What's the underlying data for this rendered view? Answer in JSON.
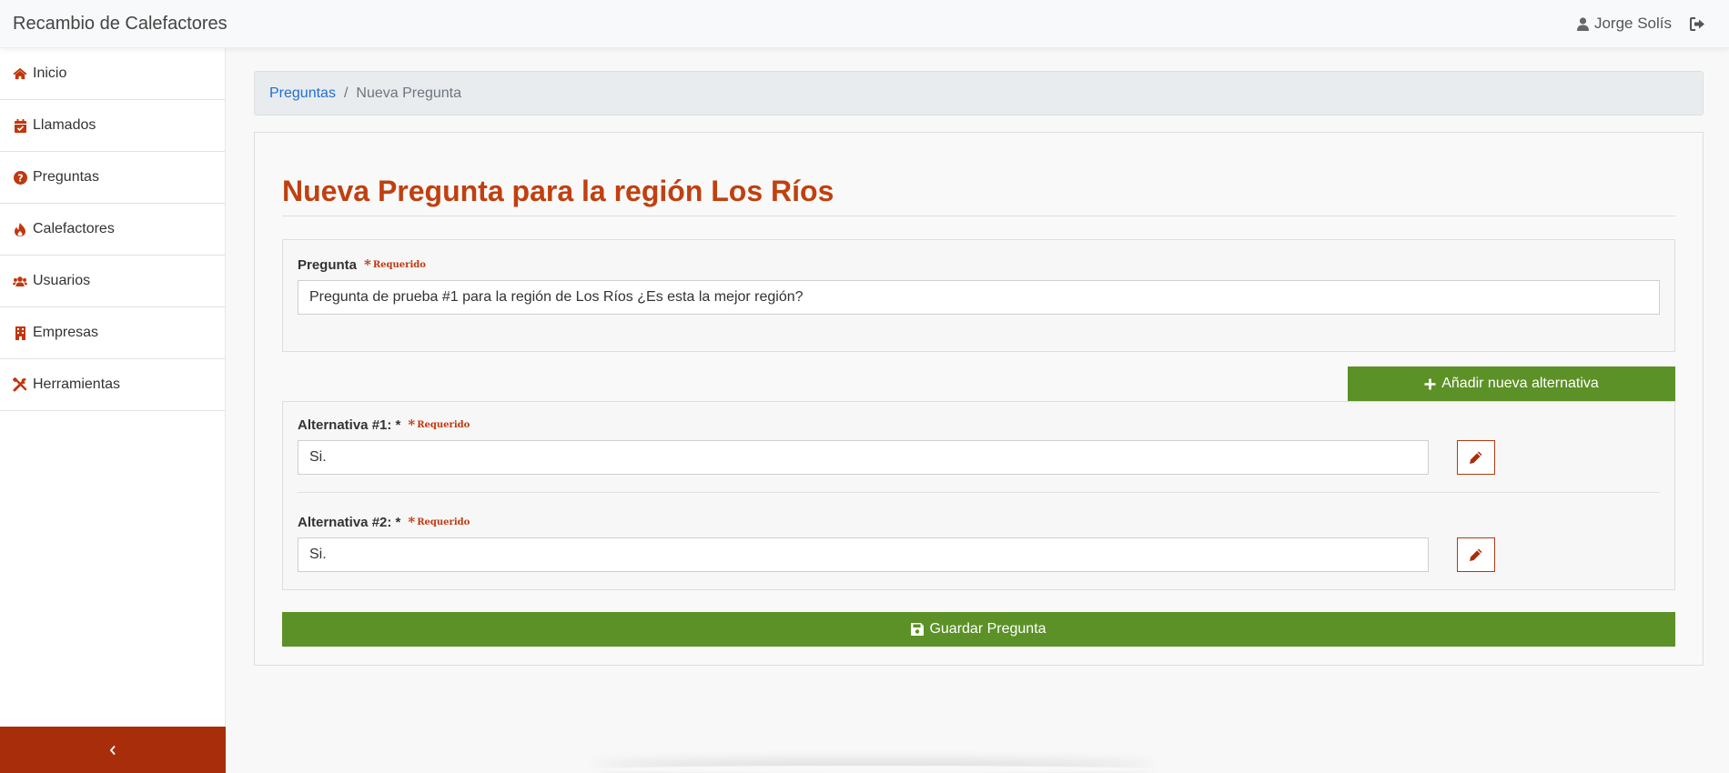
{
  "app": {
    "title": "Recambio de Calefactores",
    "user_name": "Jorge Solís",
    "accent_color": "#c0400f",
    "success_color": "#5b9126"
  },
  "sidebar": {
    "items": [
      {
        "label": "Inicio",
        "icon": "home-icon"
      },
      {
        "label": "Llamados",
        "icon": "calendar-check-icon"
      },
      {
        "label": "Preguntas",
        "icon": "question-circle-icon"
      },
      {
        "label": "Calefactores",
        "icon": "fire-icon"
      },
      {
        "label": "Usuarios",
        "icon": "users-icon"
      },
      {
        "label": "Empresas",
        "icon": "building-icon"
      },
      {
        "label": "Herramientas",
        "icon": "tools-icon"
      }
    ],
    "toggle_icon": "chevron-left-icon"
  },
  "breadcrumb": {
    "link": "Preguntas",
    "separator": "/",
    "current": "Nueva Pregunta"
  },
  "form": {
    "title": "Nueva Pregunta para la región Los Ríos",
    "question": {
      "label": "Pregunta",
      "required_text": "Requerido",
      "value": "Pregunta de prueba #1 para la región de Los Ríos ¿Es esta la mejor región?"
    },
    "add_alternative_label": "Añadir nueva alternativa",
    "alternatives": [
      {
        "label": "Alternativa #1: *",
        "required_text": "Requerido",
        "value": "Si."
      },
      {
        "label": "Alternativa #2: *",
        "required_text": "Requerido",
        "value": "Si."
      }
    ],
    "save_label": "Guardar Pregunta"
  }
}
